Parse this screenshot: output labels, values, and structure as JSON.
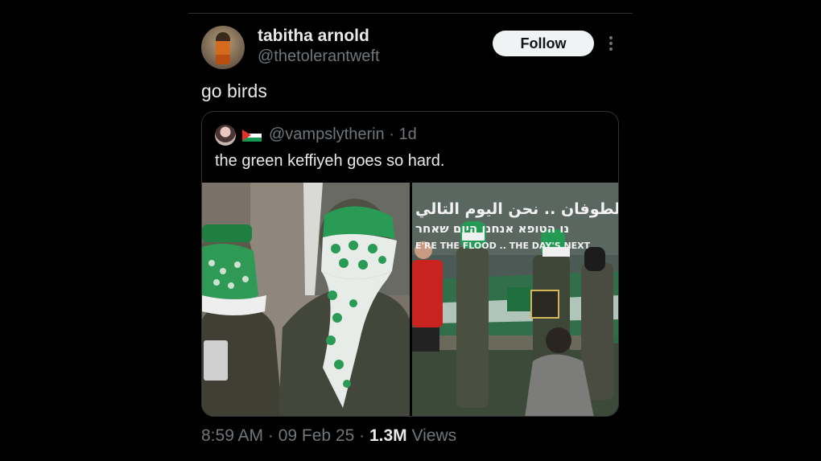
{
  "post": {
    "author_name": "tabitha arnold",
    "author_handle": "@thetolerantweft",
    "follow_label": "Follow",
    "text": "go birds",
    "time": "8:59 AM",
    "date": "09 Feb 25",
    "views_count": "1.3M",
    "views_label": "Views"
  },
  "quote": {
    "handle": "@vampslytherin",
    "age": "1d",
    "text": "the green keffiyeh goes so hard.",
    "flag": "palestine-flag",
    "banner": {
      "line1": "الطوفان .. نحن اليوم التالي",
      "line2": "נו הטופא אנחנו היום שאחר",
      "line3": "E'RE THE FLOOD .. THE DAY'S NEXT"
    }
  },
  "icons": [
    "more-icon",
    "palestine-flag-icon"
  ],
  "colors": {
    "background": "#000000",
    "text": "#e7e9ea",
    "muted": "#71767b",
    "border": "#2f3336",
    "follow_bg": "#eff3f4"
  }
}
